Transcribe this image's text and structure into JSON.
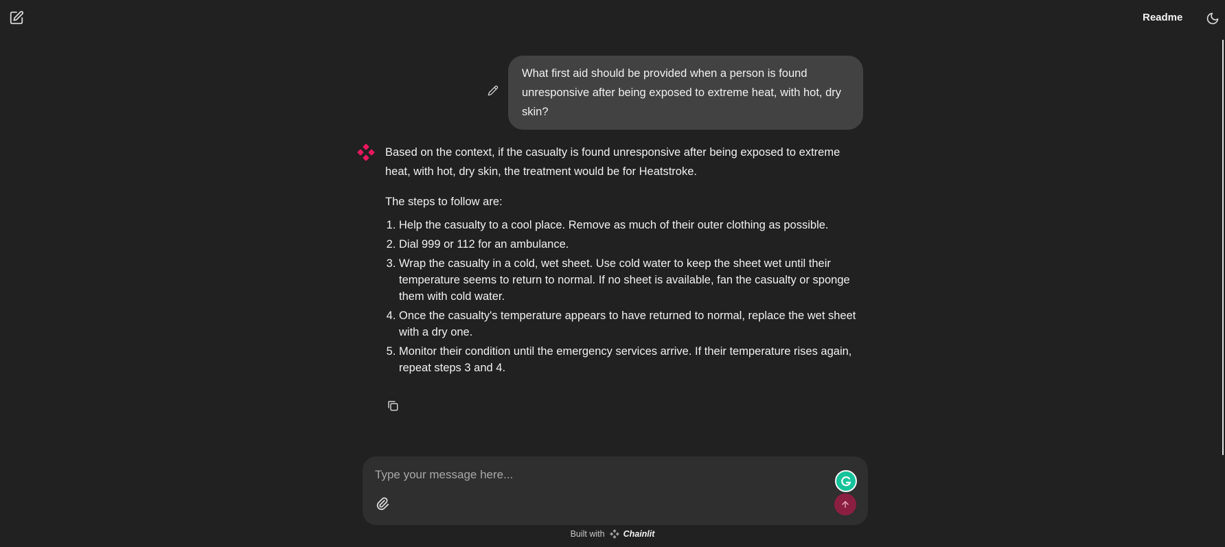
{
  "header": {
    "readme_label": "Readme"
  },
  "conversation": {
    "user_message": "What first aid should be provided when a person is found unresponsive after being exposed to extreme heat, with hot, dry skin?",
    "assistant": {
      "intro": "Based on the context, if the casualty is found unresponsive after being exposed to extreme heat, with hot, dry skin, the treatment would be for Heatstroke.",
      "steps_heading": "The steps to follow are:",
      "steps": [
        "Help the casualty to a cool place. Remove as much of their outer clothing as possible.",
        "Dial 999 or 112 for an ambulance.",
        "Wrap the casualty in a cold, wet sheet. Use cold water to keep the sheet wet until their temperature seems to return to normal. If no sheet is available, fan the casualty or sponge them with cold water.",
        "Once the casualty's temperature appears to have returned to normal, replace the wet sheet with a dry one.",
        "Monitor their condition until the emergency services arrive. If their temperature rises again, repeat steps 3 and 4."
      ]
    }
  },
  "composer": {
    "placeholder": "Type your message here...",
    "value": ""
  },
  "footer": {
    "built_with": "Built with",
    "brand": "Chainlit"
  },
  "colors": {
    "background": "#212121",
    "user_bubble": "#424242",
    "composer": "#2f2f2f",
    "send_button": "#8a1f42",
    "avatar_accent": "#e8175d",
    "grammarly": "#15c39a"
  },
  "icons": {
    "new_chat": "edit-square-icon",
    "theme": "moon-icon",
    "edit_message": "pencil-icon",
    "assistant_avatar": "chainlit-logo-icon",
    "copy": "copy-icon",
    "attach": "paperclip-icon",
    "grammarly": "grammarly-icon",
    "send": "arrow-up-icon"
  }
}
